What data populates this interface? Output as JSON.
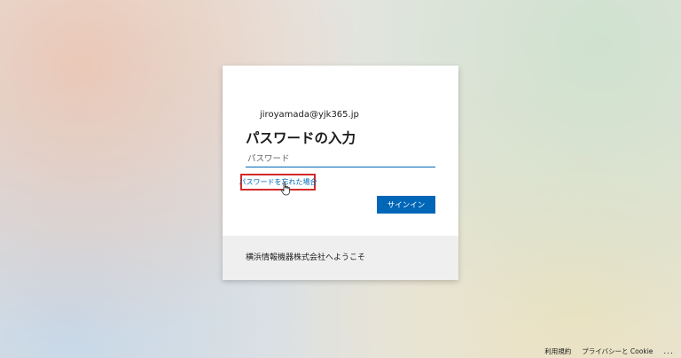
{
  "account": {
    "email": "jiroyamada@yjk365.jp"
  },
  "signin": {
    "title": "パスワードの入力",
    "password_placeholder": "パスワード",
    "forgot_link": "パスワードを忘れた場合",
    "submit_label": "サインイン",
    "highlight_color": "#d42a2a",
    "accent_color": "#0067b8"
  },
  "banner": {
    "text": "横浜情報機器株式会社へようこそ"
  },
  "footer": {
    "terms": "利用規約",
    "privacy": "プライバシーと Cookie",
    "more": "..."
  }
}
